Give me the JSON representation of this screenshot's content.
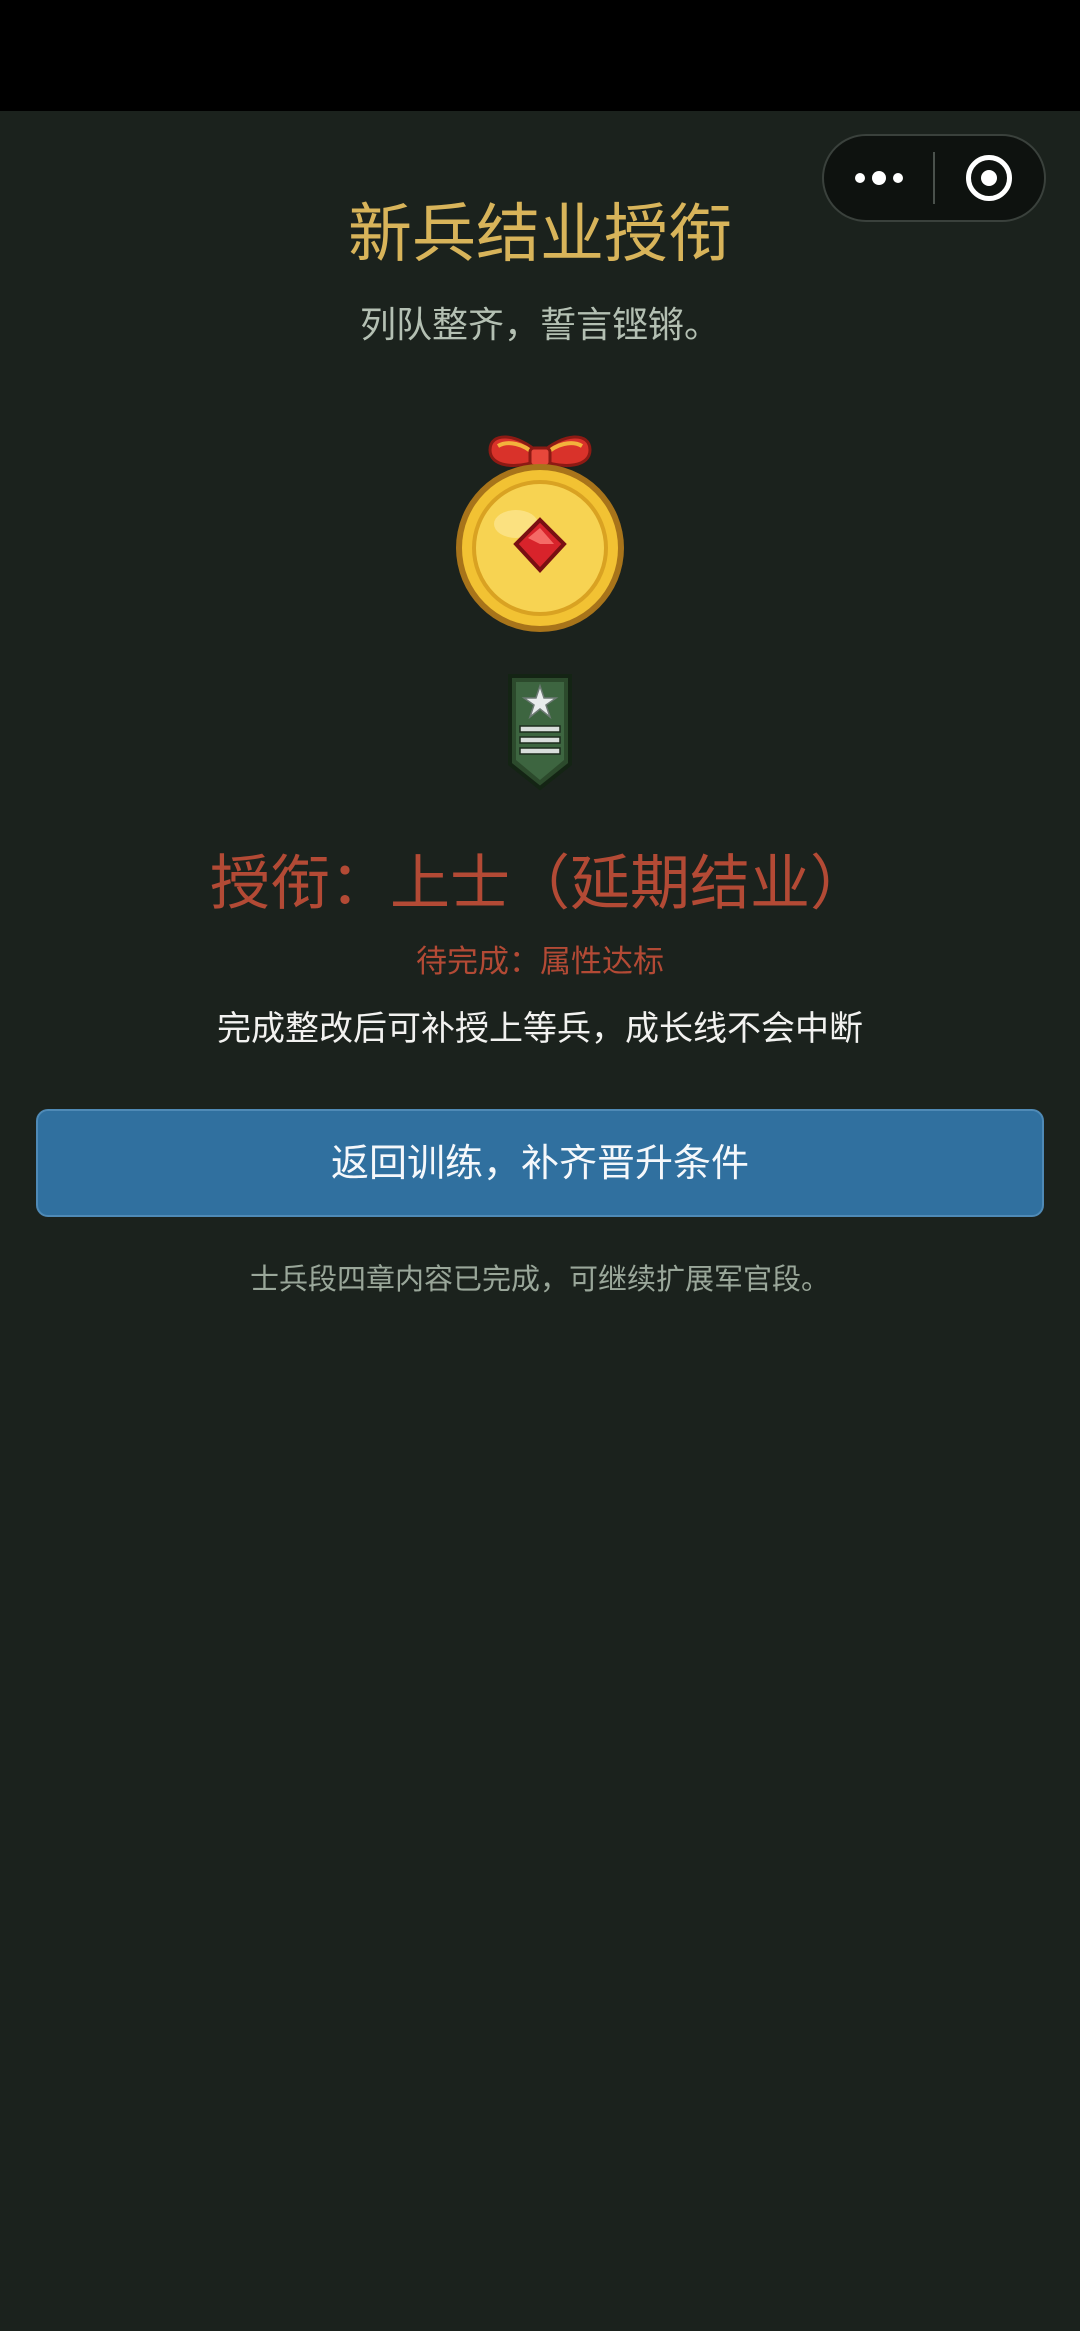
{
  "header": {
    "title": "新兵结业授衔",
    "subtitle": "列队整齐，誓言铿锵。"
  },
  "capsule": {
    "menu_icon": "more-dots-icon",
    "close_icon": "target-circle-icon"
  },
  "icons": {
    "medal": "gold-medal-with-ribbon-icon",
    "badge": "green-rank-shoulder-badge-icon"
  },
  "result": {
    "rank_title": "授衔：上士（延期结业）",
    "pending": "待完成：属性达标",
    "note": "完成整改后可补授上等兵，成长线不会中断"
  },
  "action": {
    "button_label": "返回训练，补齐晋升条件"
  },
  "footer": {
    "note": "士兵段四章内容已完成，可继续扩展军官段。"
  },
  "colors": {
    "background": "#1b221d",
    "title_gold": "#d8b45a",
    "rank_red": "#b34a35",
    "button_blue": "#30709f"
  }
}
